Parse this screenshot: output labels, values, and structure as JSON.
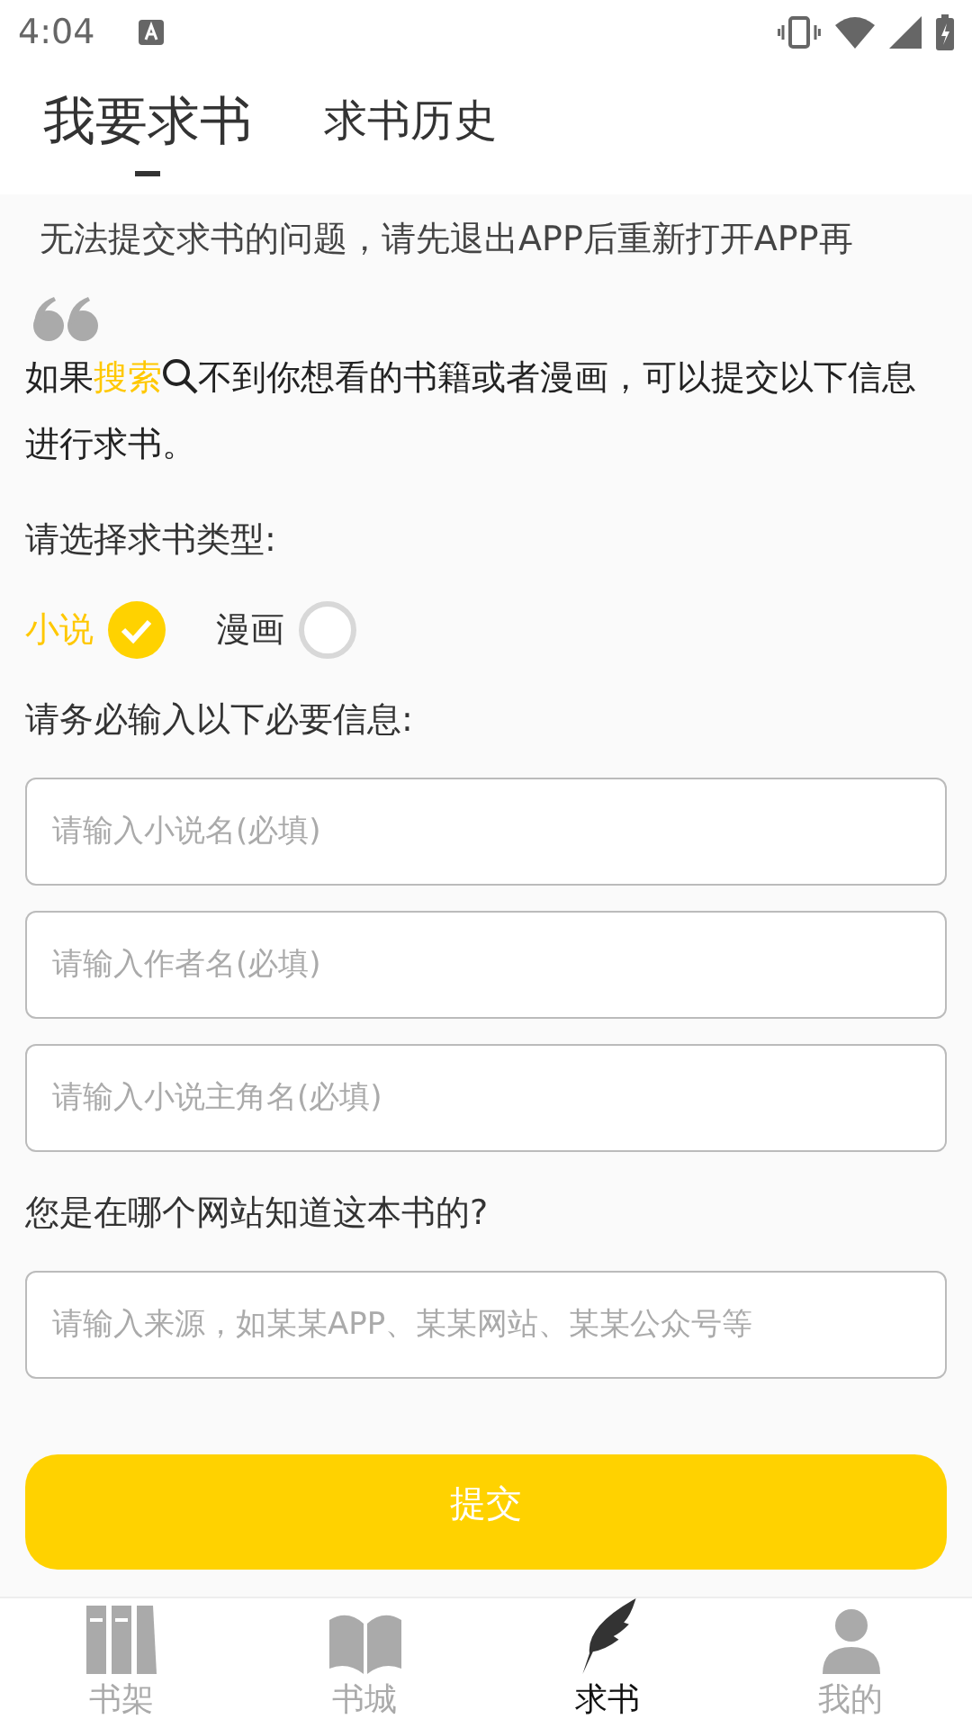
{
  "status_bar": {
    "time": "4:04"
  },
  "tabs": [
    {
      "label": "我要求书",
      "selected": true
    },
    {
      "label": "求书历史",
      "selected": false
    }
  ],
  "notice": "无法提交求书的问题，请先退出APP后重新打开APP再",
  "intro": {
    "before": "如果",
    "link": "搜索",
    "after": "不到你想看的书籍或者漫画，可以提交以下信息进行求书。"
  },
  "type_label": "请选择求书类型:",
  "types": [
    {
      "label": "小说",
      "selected": true
    },
    {
      "label": "漫画",
      "selected": false
    }
  ],
  "required_label": "请务必输入以下必要信息:",
  "fields": [
    {
      "placeholder": "请输入小说名(必填)"
    },
    {
      "placeholder": "请输入作者名(必填)"
    },
    {
      "placeholder": "请输入小说主角名(必填)"
    }
  ],
  "source_label": "您是在哪个网站知道这本书的?",
  "source_field": {
    "placeholder": "请输入来源，如某某APP、某某网站、某某公众号等"
  },
  "submit": "提交",
  "nav": [
    {
      "label": "书架",
      "kind": "shelf",
      "selected": false
    },
    {
      "label": "书城",
      "kind": "book",
      "selected": false
    },
    {
      "label": "求书",
      "kind": "quill",
      "selected": true
    },
    {
      "label": "我的",
      "kind": "person",
      "selected": false
    }
  ]
}
